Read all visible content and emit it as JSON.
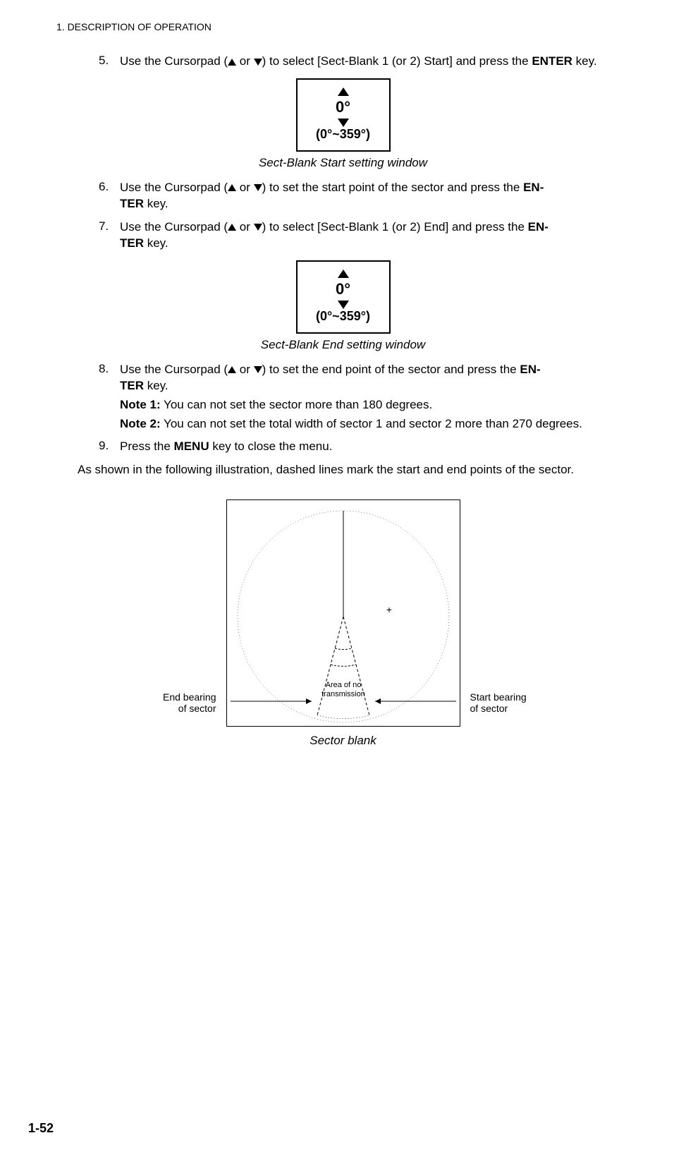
{
  "header": "1.  DESCRIPTION OF OPERATION",
  "steps": {
    "s5": {
      "num": "5.",
      "text_a": "Use the Cursorpad (",
      "text_b": " or ",
      "text_c": ") to select [Sect-Blank 1 (or 2) Start] and press the ",
      "enter": "ENTER",
      "text_d": " key."
    },
    "s6": {
      "num": "6.",
      "text_a": "Use the Cursorpad (",
      "text_b": " or ",
      "text_c": ") to set the start point of the sector and press the ",
      "en": "EN-",
      "ter": "TER",
      "text_d": " key."
    },
    "s7": {
      "num": "7.",
      "text_a": "Use the Cursorpad (",
      "text_b": " or ",
      "text_c": ") to select [Sect-Blank 1 (or 2) End] and press the ",
      "en": "EN-",
      "ter": "TER",
      "text_d": " key."
    },
    "s8": {
      "num": "8.",
      "text_a": "Use the Cursorpad (",
      "text_b": " or ",
      "text_c": ") to set the end point of the sector and press the ",
      "en": "EN-",
      "ter": "TER",
      "text_d": " key.",
      "note1_label": "Note 1:",
      "note1_text": " You can not set the sector more than 180 degrees.",
      "note2_label": "Note 2:",
      "note2_text": " You can not set the total width of sector 1 and sector 2 more than 270 degrees."
    },
    "s9": {
      "num": "9.",
      "text_a": "Press the ",
      "menu": "MENU",
      "text_b": " key to close the menu."
    }
  },
  "fig1": {
    "value": "0°",
    "range": "(0°~359°)",
    "caption": "Sect-Blank Start setting window"
  },
  "fig2": {
    "value": "0°",
    "range": "(0°~359°)",
    "caption": "Sect-Blank End setting window"
  },
  "body_para": "As shown in the following illustration, dashed lines mark the start and end points of the sector.",
  "diagram": {
    "end_label_l1": "End bearing",
    "end_label_l2": "of sector",
    "start_label_l1": "Start bearing",
    "start_label_l2": "of sector",
    "area_l1": "Area of no",
    "area_l2": "transmission",
    "plus": "+",
    "caption": "Sector blank"
  },
  "footer": "1-52"
}
